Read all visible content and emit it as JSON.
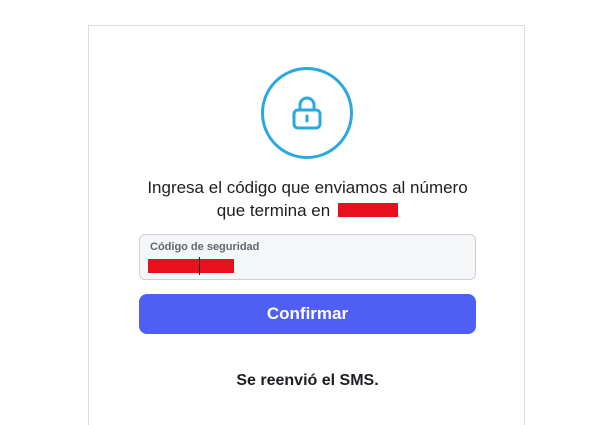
{
  "verification": {
    "lock_icon": "padlock-icon",
    "instruction_line1": "Ingresa el código que enviamos al número",
    "instruction_line2": "que termina en",
    "code_field": {
      "label": "Código de seguridad"
    },
    "confirm_label": "Confirmar",
    "resent_message": "Se reenvió el SMS."
  },
  "colors": {
    "accent": "#4f5ff3",
    "lock_ring": "#29a9df",
    "redaction": "#e8101c",
    "field_background": "#f5f6f7"
  }
}
